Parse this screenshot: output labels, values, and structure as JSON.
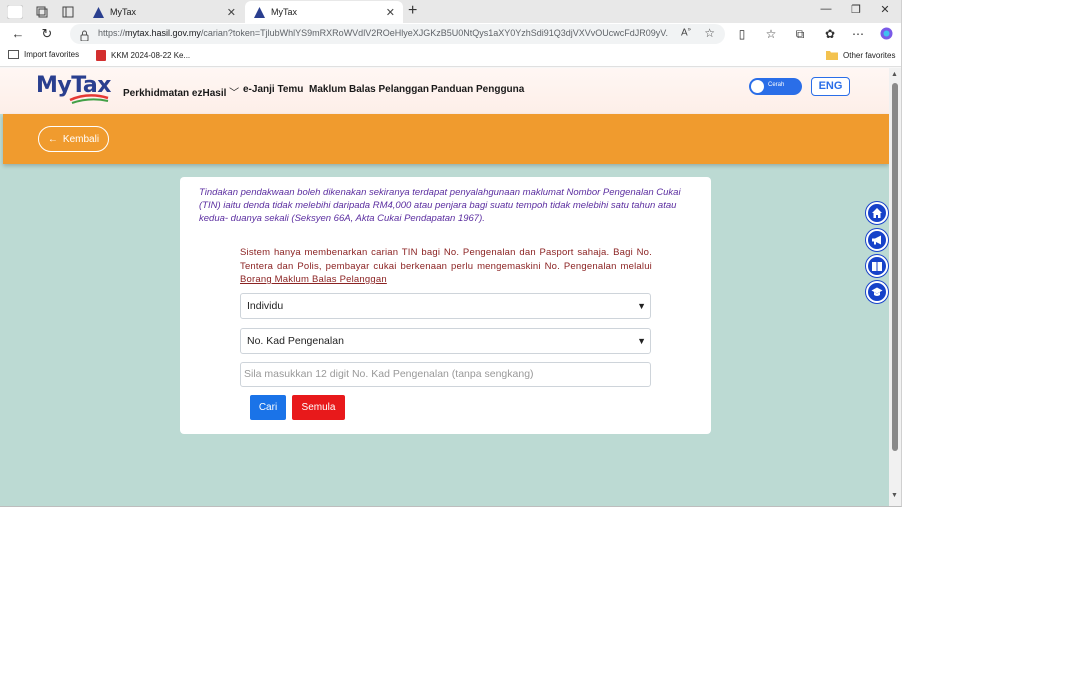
{
  "browser": {
    "tabs": [
      {
        "title": "MyTax",
        "active": false
      },
      {
        "title": "MyTax",
        "active": true
      }
    ],
    "url_prefix": "https://",
    "url_host": "mytax.hasil.gov.my",
    "url_rest": "/carian?token=TjlubWhlYS9mRXRoWVdlV2ROeHlyeXJGKzB5U0NtQys1aXY0YzhSdi91Q3djVXVvOUcwcFdJR09yV...",
    "favorites": [
      {
        "label": "Import favorites"
      },
      {
        "label": "KKM 2024-08-22 Ke..."
      }
    ],
    "other_favorites": "Other favorites"
  },
  "site": {
    "logo": "MyTax",
    "menu": [
      "Perkhidmatan ezHasil",
      "e-Janji Temu",
      "Maklum Balas Pelanggan",
      "Panduan Pengguna"
    ],
    "theme_toggle_label": "Cerah",
    "lang_button": "ENG",
    "back_label": "Kembali",
    "accent_orange": "#f09b2e",
    "accent_blue": "#1742c9"
  },
  "card": {
    "warning": "Tindakan pendakwaan boleh dikenakan sekiranya terdapat penyalahgunaan maklumat Nombor Pengenalan Cukai (TIN) iaitu denda tidak melebihi daripada RM4,000 atau penjara bagi suatu tempoh tidak melebihi satu tahun atau kedua- duanya sekali (Seksyen 66A, Akta Cukai Pendapatan 1967).",
    "notice_text": "Sistem hanya membenarkan carian TIN bagi No. Pengenalan dan Pasport sahaja. Bagi No. Tentera dan Polis, pembayar cukai berkenaan perlu mengemaskini No. Pengenalan melalui ",
    "notice_link": "Borang Maklum Balas Pelanggan",
    "select_type": "Individu",
    "select_id": "No. Kad Pengenalan",
    "input_placeholder": "Sila masukkan 12 digit No. Kad Pengenalan (tanpa sengkang)",
    "search_button": "Cari",
    "reset_button": "Semula"
  },
  "floating_icons": [
    "home-icon",
    "megaphone-icon",
    "book-icon",
    "graduation-cap-icon"
  ]
}
